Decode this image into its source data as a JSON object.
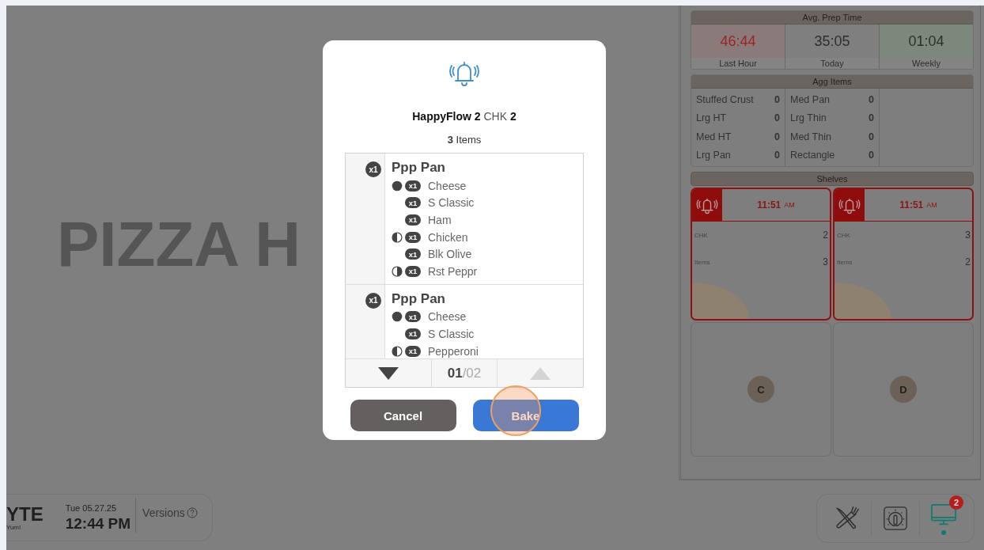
{
  "background": {
    "brand_text": "PIZZA H"
  },
  "status_card": {
    "logo": "YTE",
    "tagline": "Yum!",
    "date": "Tue 05.27.25",
    "time": "12:44 PM",
    "versions_link": "Versions"
  },
  "avg_prep_time": {
    "title": "Avg. Prep Time",
    "cells": [
      {
        "value": "46:44",
        "label": "Last Hour",
        "color": "#8a7a7a",
        "alert": true
      },
      {
        "value": "35:05",
        "label": "Today",
        "color": "#7f7f7f",
        "alert": false
      },
      {
        "value": "01:04",
        "label": "Weekly",
        "color": "#7d887d",
        "alert": false
      }
    ]
  },
  "agg_items": {
    "title": "Agg Items",
    "columns": [
      {
        "rows": [
          {
            "name": "Stuffed Crust",
            "count": "0"
          },
          {
            "name": "Lrg HT",
            "count": "0"
          },
          {
            "name": "Med HT",
            "count": "0"
          },
          {
            "name": "Lrg Pan",
            "count": "0"
          }
        ]
      },
      {
        "rows": [
          {
            "name": "Med Pan",
            "count": "0"
          },
          {
            "name": "Lrg Thin",
            "count": "0"
          },
          {
            "name": "Med Thin",
            "count": "0"
          },
          {
            "name": "Rectangle",
            "count": "0"
          }
        ]
      }
    ]
  },
  "shelves": {
    "title": "Shelves",
    "slots": [
      {
        "kind": "order",
        "time": "11:51",
        "meridiem": "AM",
        "chk_label": "CHK",
        "chk": "2",
        "items_label": "Items",
        "items": "3"
      },
      {
        "kind": "order",
        "time": "11:51",
        "meridiem": "AM",
        "chk_label": "CHK",
        "chk": "3",
        "items_label": "Items",
        "items": "2"
      },
      {
        "kind": "empty",
        "label": "C"
      },
      {
        "kind": "empty",
        "label": "D"
      }
    ]
  },
  "toolbar": [
    {
      "kind": "utensils",
      "selected": false
    },
    {
      "kind": "timer",
      "selected": false
    },
    {
      "kind": "monitor",
      "selected": true,
      "badge": "2"
    }
  ],
  "dialog": {
    "title": "**HappyFlow 2** CHK **2**",
    "subtitle": "**3** Items",
    "items": [
      {
        "qty": "x1",
        "name": "Ppp Pan",
        "toppings": [
          {
            "kind": "whole",
            "qty": "x1",
            "name": "Cheese"
          },
          {
            "kind": "plain",
            "qty": "x1",
            "name": "S Classic"
          },
          {
            "kind": "plain",
            "qty": "x1",
            "name": "Ham"
          },
          {
            "kind": "left",
            "qty": "x1",
            "name": "Chicken"
          },
          {
            "kind": "plain",
            "qty": "x1",
            "name": "Blk Olive"
          },
          {
            "kind": "right",
            "qty": "x1",
            "name": "Rst Peppr"
          }
        ]
      },
      {
        "qty": "x1",
        "name": "Ppp Pan",
        "toppings": [
          {
            "kind": "whole",
            "qty": "x1",
            "name": "Cheese"
          },
          {
            "kind": "plain",
            "qty": "x1",
            "name": "S Classic"
          },
          {
            "kind": "left",
            "qty": "x1",
            "name": "Pepperoni"
          }
        ]
      }
    ],
    "pager": {
      "current": "01",
      "total": "/02",
      "down_disabled": false,
      "up_disabled": true
    },
    "buttons": [
      {
        "kind": "cancel",
        "label": "Cancel"
      },
      {
        "kind": "confirm",
        "label": "Bake",
        "highlighted": true
      }
    ]
  }
}
